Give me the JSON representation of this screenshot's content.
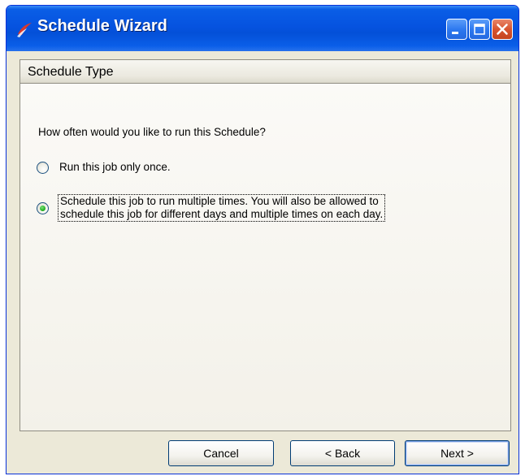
{
  "window": {
    "title": "Schedule Wizard",
    "title_bar_color": "#0654e0",
    "controls": [
      "minimize-icon",
      "maximize-icon",
      "close-icon"
    ]
  },
  "header": {
    "title": "Schedule Type"
  },
  "main": {
    "question": "How often would you like to run this Schedule?",
    "options": [
      {
        "label": "Run this job only once.",
        "selected": false
      },
      {
        "label_line1": "Schedule this job to run multiple times. You will also be allowed to",
        "label_line2": "schedule this job for different days and multiple times on each day.",
        "selected": true
      }
    ]
  },
  "footer": {
    "cancel_label": "Cancel",
    "back_label": "< Back",
    "next_label": "Next >"
  }
}
